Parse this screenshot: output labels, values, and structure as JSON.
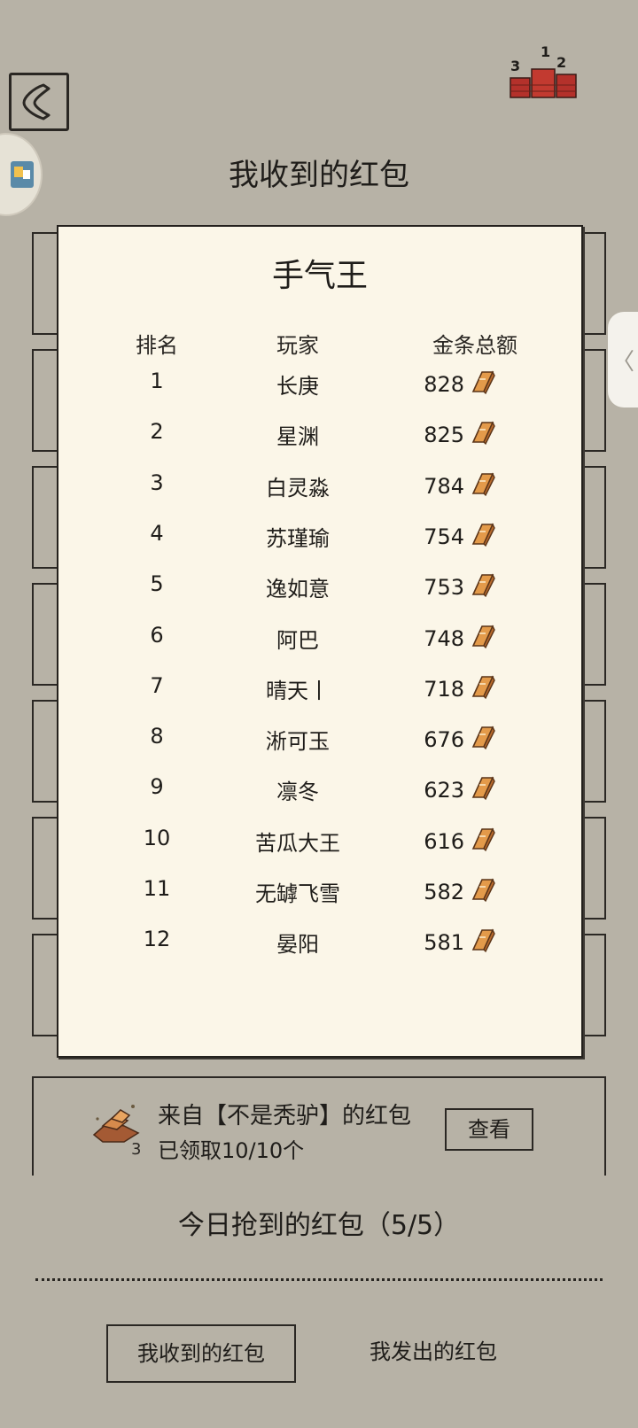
{
  "header": {
    "title": "我收到的红包",
    "back_icon": "back-arrow-icon",
    "rank_icon": "ranking-podium-icon",
    "rank_icon_digits": [
      "3",
      "1",
      "2"
    ],
    "side_float_icon": "side-widget-icon",
    "edge_tab_icon": "chevron-left-icon",
    "edge_tab_glyph": "〈"
  },
  "leaderboard": {
    "title": "手气王",
    "columns": {
      "rank": "排名",
      "player": "玩家",
      "gold": "金条总额"
    },
    "gold_icon": "gold-bar-icon",
    "rows": [
      {
        "rank": "1",
        "player": "长庚",
        "gold": "828"
      },
      {
        "rank": "2",
        "player": "星渊",
        "gold": "825"
      },
      {
        "rank": "3",
        "player": "白灵淼",
        "gold": "784"
      },
      {
        "rank": "4",
        "player": "苏瑾瑜",
        "gold": "754"
      },
      {
        "rank": "5",
        "player": "逸如意",
        "gold": "753"
      },
      {
        "rank": "6",
        "player": "阿巴",
        "gold": "748"
      },
      {
        "rank": "7",
        "player": "晴天丨",
        "gold": "718"
      },
      {
        "rank": "8",
        "player": "淅可玉",
        "gold": "676"
      },
      {
        "rank": "9",
        "player": "凛冬",
        "gold": "623"
      },
      {
        "rank": "10",
        "player": "苦瓜大王",
        "gold": "616"
      },
      {
        "rank": "11",
        "player": "无罅飞雪",
        "gold": "582"
      },
      {
        "rank": "12",
        "player": "晏阳",
        "gold": "581"
      }
    ]
  },
  "packet": {
    "icon": "gold-pile-icon",
    "count": "3",
    "from": "来自【不是秃驴】的红包",
    "status": "已领取10/10个",
    "view_label": "查看"
  },
  "today": {
    "label": "今日抢到的红包（5/5）"
  },
  "tabs": {
    "received": "我收到的红包",
    "sent": "我发出的红包"
  },
  "colors": {
    "background": "#b7b2a6",
    "panel": "#fbf6e8",
    "ink": "#1f1d1a",
    "gold": "#e39a4a"
  }
}
